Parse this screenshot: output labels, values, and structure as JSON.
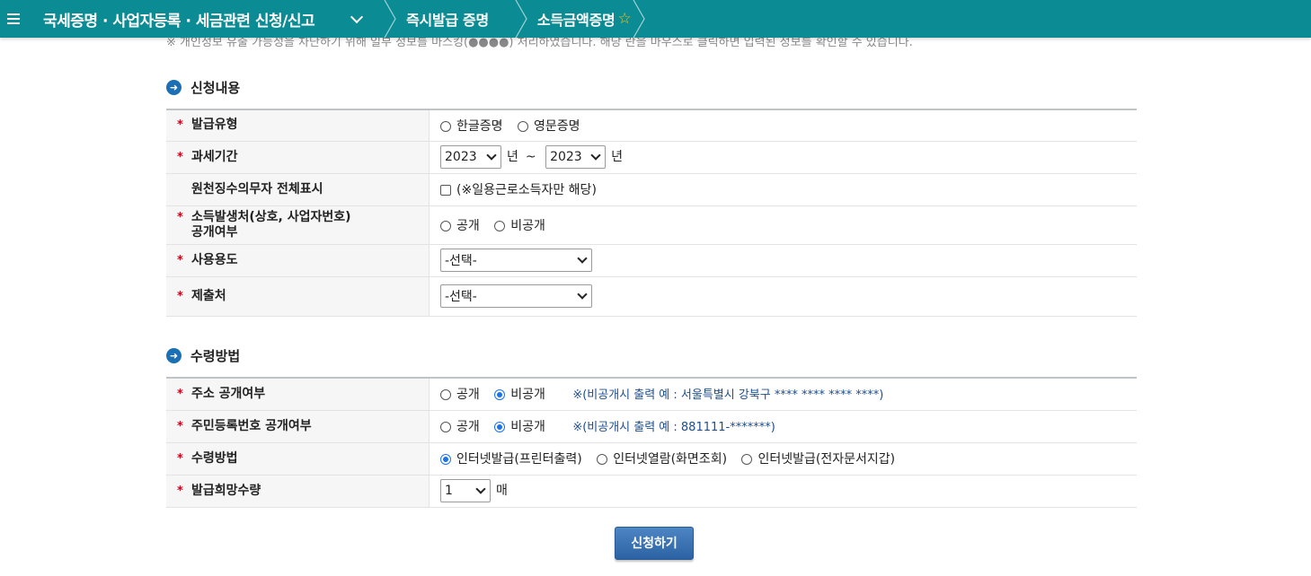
{
  "nav": {
    "main_title": "국세증명 · 사업자등록 · 세금관련 신청/신고",
    "crumbs": [
      "즉시발급 증명",
      "소득금액증명"
    ]
  },
  "subnote": "※ 개인정보 유출 가능성을 차단하기 위해 일부 정보를 마스킹(●●●●) 처리하였습니다. 해당 란을 마우스로 클릭하면 입력된 정보를 확인할 수 있습니다.",
  "section1": {
    "title": "신청내용",
    "issue_type": {
      "label": "발급유형",
      "options": [
        "한글증명",
        "영문증명"
      ]
    },
    "tax_period": {
      "label": "과세기간",
      "from": "2023",
      "to": "2023",
      "unit": "년",
      "tilde": "~"
    },
    "withholding": {
      "label": "원천징수의무자 전체표시",
      "note": "(※일용근로소득자만 해당)"
    },
    "income_source": {
      "label_line1": "소득발생처(상호, 사업자번호)",
      "label_line2": "공개여부",
      "options": [
        "공개",
        "비공개"
      ]
    },
    "purpose": {
      "label": "사용용도",
      "value": "-선택-"
    },
    "submit_to": {
      "label": "제출처",
      "value": "-선택-"
    }
  },
  "section2": {
    "title": "수령방법",
    "address": {
      "label": "주소 공개여부",
      "options": [
        "공개",
        "비공개"
      ],
      "note": "※(비공개시 출력 예 : 서울특별시 강북구 **** **** **** ****)"
    },
    "rrn": {
      "label": "주민등록번호 공개여부",
      "options": [
        "공개",
        "비공개"
      ],
      "note": "※(비공개시 출력 예 : 881111-*******)"
    },
    "method": {
      "label": "수령방법",
      "options": [
        "인터넷발급(프린터출력)",
        "인터넷열람(화면조회)",
        "인터넷발급(전자문서지갑)"
      ]
    },
    "quantity": {
      "label": "발급희망수량",
      "value": "1",
      "unit": "매"
    }
  },
  "submit_label": "신청하기",
  "required_mark": "*"
}
